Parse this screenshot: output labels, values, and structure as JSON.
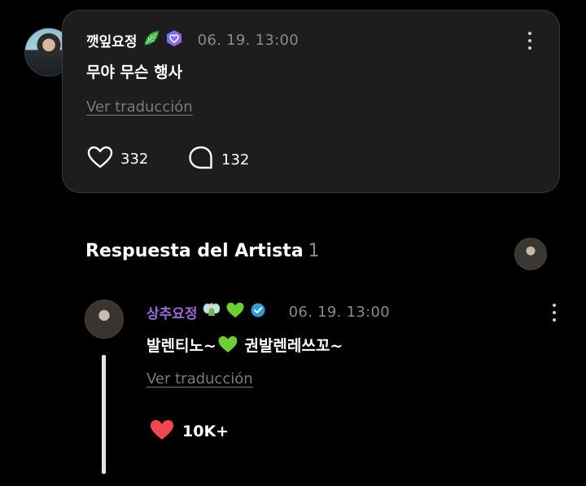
{
  "post": {
    "username": "깻잎요정",
    "timestamp": "06. 19. 13:00",
    "body": "무야 무슨 행사",
    "translate_label": "Ver traducción",
    "likes": "332",
    "comments": "132"
  },
  "artist_section": {
    "title": "Respuesta del Artista",
    "count": "1"
  },
  "reply": {
    "username": "상추요정",
    "timestamp": "06. 19. 13:00",
    "body_part1": "발렌티노~",
    "body_part2": " 권발렌레쓰꼬~",
    "translate_label": "Ver traducción",
    "likes": "10K+"
  },
  "colors": {
    "background": "#000000",
    "card": "#1d1d1d",
    "reply_username": "#9b67d8",
    "muted_text": "#8a8a8a",
    "like_red": "#f2474f",
    "green_heart": "#6cd12e",
    "verify_blue": "#2f9bd8"
  },
  "icons": [
    "leaf-icon",
    "fan-badge-icon",
    "more-icon",
    "heart-outline-icon",
    "comment-bubble-icon",
    "fairy-icon",
    "green-heart-icon",
    "verified-icon",
    "heart-filled-icon"
  ]
}
